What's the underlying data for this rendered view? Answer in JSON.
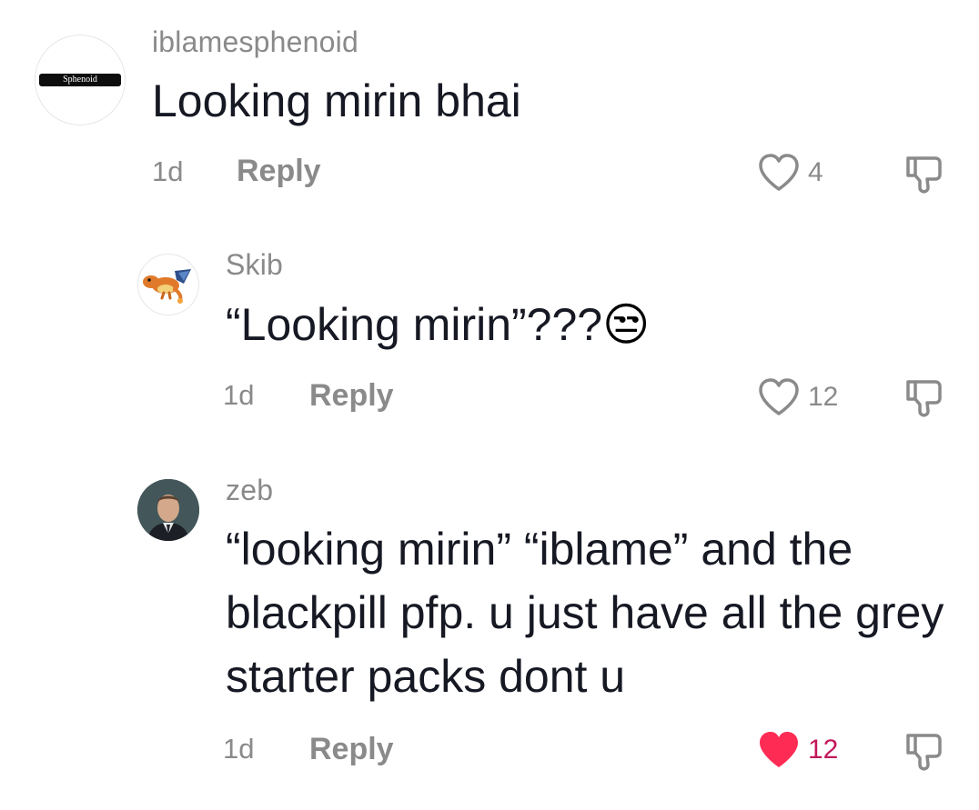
{
  "comments": [
    {
      "username": "iblamesphenoid",
      "text": "Looking mirin bhai",
      "avatar_label": "Sphenoid",
      "time": "1d",
      "reply_label": "Reply",
      "likes": "4",
      "liked": false
    },
    {
      "username": "Skib",
      "text": "“Looking mirin”???",
      "emoji": "😒",
      "time": "1d",
      "reply_label": "Reply",
      "likes": "12",
      "liked": false
    },
    {
      "username": "zeb",
      "text": "“looking mirin” “iblame” and the blackpill pfp. u just have all the grey starter packs dont u",
      "time": "1d",
      "reply_label": "Reply",
      "likes": "12",
      "liked": true
    }
  ],
  "colors": {
    "text": "#161823",
    "muted": "#8a8a8a",
    "liked": "#fe2c55"
  },
  "icons": [
    "heart-outline-icon",
    "heart-filled-icon",
    "dislike-icon"
  ]
}
